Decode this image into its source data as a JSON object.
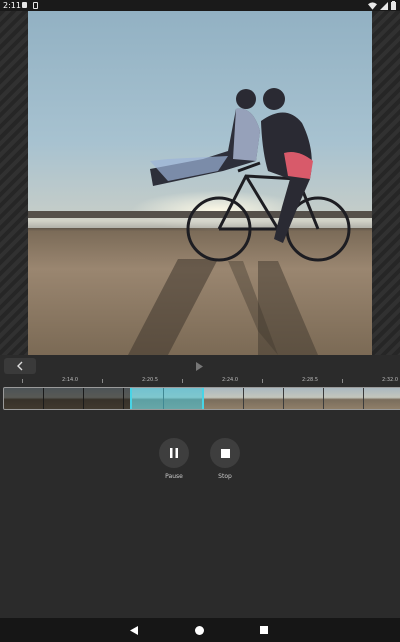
{
  "status_bar": {
    "time": "2:11"
  },
  "timeline": {
    "time_labels": [
      "2:14.0",
      "2:20.5",
      "2:24.0",
      "2:28.5",
      "2:32.0"
    ]
  },
  "playback": {
    "pause_label": "Pause",
    "stop_label": "Stop"
  },
  "colors": {
    "selection": "#48d4e6",
    "background": "#2b2b2b"
  }
}
